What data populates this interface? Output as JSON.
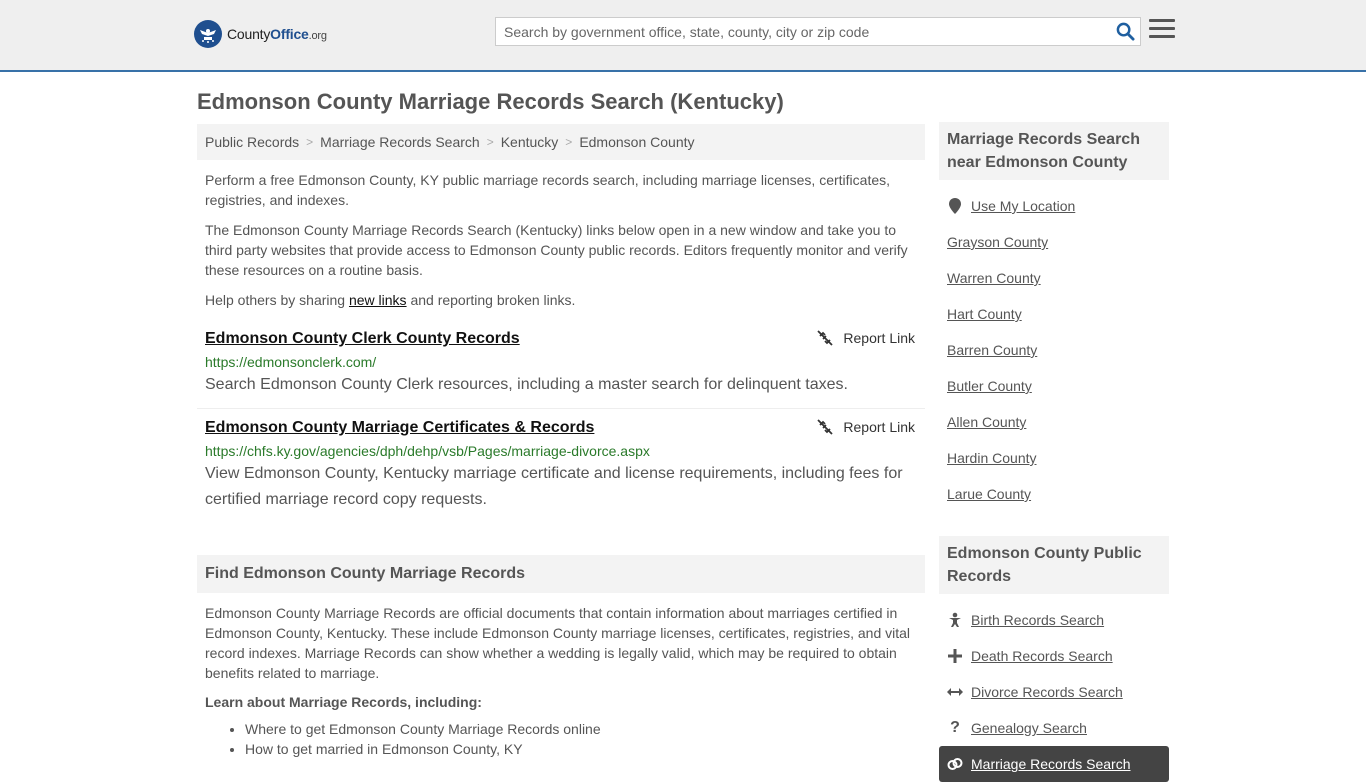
{
  "brand": {
    "county": "County",
    "office": "Office",
    "org": ".org"
  },
  "search": {
    "placeholder": "Search by government office, state, county, city or zip code"
  },
  "page_title": "Edmonson County Marriage Records Search (Kentucky)",
  "breadcrumb": [
    "Public Records",
    "Marriage Records Search",
    "Kentucky",
    "Edmonson County"
  ],
  "intro": {
    "p1": "Perform a free Edmonson County, KY public marriage records search, including marriage licenses, certificates, registries, and indexes.",
    "p2": "The Edmonson County Marriage Records Search (Kentucky) links below open in a new window and take you to third party websites that provide access to Edmonson County public records. Editors frequently monitor and verify these resources on a routine basis.",
    "p3_before": "Help others by sharing ",
    "p3_link": "new links",
    "p3_after": " and reporting broken links."
  },
  "report_label": "Report Link",
  "records": [
    {
      "title": "Edmonson County Clerk County Records",
      "url": "https://edmonsonclerk.com/",
      "desc": "Search Edmonson County Clerk resources, including a master search for delinquent taxes."
    },
    {
      "title": "Edmonson County Marriage Certificates & Records",
      "url": "https://chfs.ky.gov/agencies/dph/dehp/vsb/Pages/marriage-divorce.aspx",
      "desc": "View Edmonson County, Kentucky marriage certificate and license requirements, including fees for certified marriage record copy requests."
    }
  ],
  "find": {
    "heading": "Find Edmonson County Marriage Records",
    "body": "Edmonson County Marriage Records are official documents that contain information about marriages certified in Edmonson County, Kentucky. These include Edmonson County marriage licenses, certificates, registries, and vital record indexes. Marriage Records can show whether a wedding is legally valid, which may be required to obtain benefits related to marriage.",
    "learn_heading": "Learn about Marriage Records, including:",
    "learn_items": [
      "Where to get Edmonson County Marriage Records online",
      "How to get married in Edmonson County, KY"
    ]
  },
  "nearby": {
    "heading": "Marriage Records Search near Edmonson County",
    "use_location": "Use My Location",
    "counties": [
      "Grayson County",
      "Warren County",
      "Hart County",
      "Barren County",
      "Butler County",
      "Allen County",
      "Hardin County",
      "Larue County"
    ]
  },
  "public_records": {
    "heading": "Edmonson County Public Records",
    "items": [
      {
        "label": "Birth Records Search",
        "icon": "birth-icon"
      },
      {
        "label": "Death Records Search",
        "icon": "cross-icon"
      },
      {
        "label": "Divorce Records Search",
        "icon": "arrows-icon"
      },
      {
        "label": "Genealogy Search",
        "icon": "question-icon"
      },
      {
        "label": "Marriage Records Search",
        "icon": "rings-icon"
      }
    ]
  },
  "colors": {
    "accent": "#3871a8",
    "link_green": "#2a7a2a",
    "brand_blue": "#1f4f8f"
  }
}
